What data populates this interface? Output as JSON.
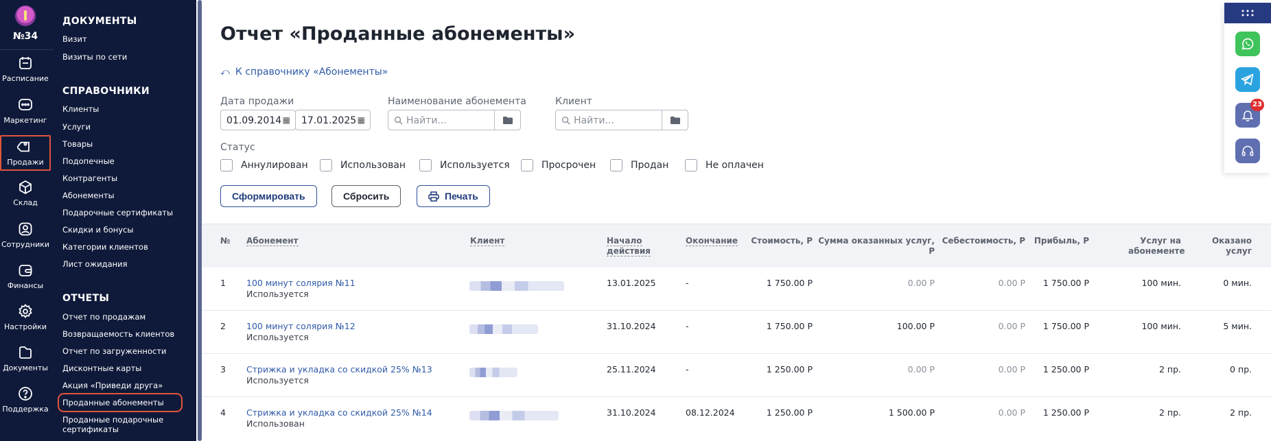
{
  "rail": {
    "branch": "№34",
    "items": [
      {
        "label": "Расписание",
        "icon": "calendar-icon"
      },
      {
        "label": "Маркетинг",
        "icon": "chat-icon"
      },
      {
        "label": "Продажи",
        "icon": "tag-icon"
      },
      {
        "label": "Склад",
        "icon": "box-icon"
      },
      {
        "label": "Сотрудники",
        "icon": "user-icon"
      },
      {
        "label": "Финансы",
        "icon": "wallet-icon"
      },
      {
        "label": "Настройки",
        "icon": "gear-icon"
      },
      {
        "label": "Документы",
        "icon": "folder-icon"
      },
      {
        "label": "Поддержка",
        "icon": "help-icon"
      }
    ],
    "active_index": 2
  },
  "submenu": {
    "documents": {
      "title": "ДОКУМЕНТЫ",
      "items": [
        "Визит",
        "Визиты по сети"
      ]
    },
    "references": {
      "title": "СПРАВОЧНИКИ",
      "items": [
        "Клиенты",
        "Услуги",
        "Товары",
        "Подопечные",
        "Контрагенты",
        "Абонементы",
        "Подарочные сертификаты",
        "Скидки и бонусы",
        "Категории клиентов",
        "Лист ожидания"
      ]
    },
    "reports": {
      "title": "ОТЧЕТЫ",
      "items": [
        "Отчет по продажам",
        "Возвращаемость клиентов",
        "Отчет по загруженности",
        "Дисконтные карты",
        "Акция «Приведи друга»",
        "Проданные абонементы",
        "Проданные подарочные",
        "сертификаты"
      ]
    },
    "active_report": "Проданные абонементы"
  },
  "page": {
    "title": "Отчет «Проданные абонементы»",
    "back_link": "К справочнику «Абонементы»"
  },
  "filters": {
    "sale_date": {
      "label": "Дата продажи",
      "from": "01.09.2014",
      "to": "17.01.2025"
    },
    "subscription_name": {
      "label": "Наименование абонемента",
      "placeholder": "Найти..."
    },
    "client": {
      "label": "Клиент",
      "placeholder": "Найти..."
    },
    "status": {
      "label": "Статус",
      "options": [
        {
          "label": "Аннулирован",
          "checked": false
        },
        {
          "label": "Использован",
          "checked": false
        },
        {
          "label": "Используется",
          "checked": false
        },
        {
          "label": "Просрочен",
          "checked": false
        },
        {
          "label": "Продан",
          "checked": false
        },
        {
          "label": "Не оплачен",
          "checked": false
        }
      ]
    }
  },
  "actions": {
    "generate": "Сформировать",
    "reset": "Сбросить",
    "print": "Печать"
  },
  "table": {
    "headers": {
      "num": "№",
      "subscription": "Абонемент",
      "client": "Клиент",
      "start": "Начало действия",
      "end": "Окончание",
      "cost": "Стоимость, Р",
      "services_sum": "Сумма оказанных услуг, Р",
      "prime_cost": "Себестоимость, Р",
      "profit": "Прибыль, Р",
      "services_total": "Услуг на абонементе",
      "services_done": "Оказано услуг"
    },
    "rows": [
      {
        "num": "1",
        "name": "100 минут солярия №11",
        "status": "Используется",
        "start": "13.01.2025",
        "end": "-",
        "cost": "1 750.00 Р",
        "services_sum": "0.00 Р",
        "prime_cost": "0.00 Р",
        "profit": "1 750.00 Р",
        "services_total": "100 мин.",
        "services_done": "0 мин."
      },
      {
        "num": "2",
        "name": "100 минут солярия №12",
        "status": "Используется",
        "start": "31.10.2024",
        "end": "-",
        "cost": "1 750.00 Р",
        "services_sum": "100.00 Р",
        "prime_cost": "0.00 Р",
        "profit": "1 750.00 Р",
        "services_total": "100 мин.",
        "services_done": "5 мин."
      },
      {
        "num": "3",
        "name": "Стрижка и укладка со скидкой 25% №13",
        "status": "Используется",
        "start": "25.11.2024",
        "end": "-",
        "cost": "1 250.00 Р",
        "services_sum": "0.00 Р",
        "prime_cost": "0.00 Р",
        "profit": "1 250.00 Р",
        "services_total": "2 пр.",
        "services_done": "0 пр."
      },
      {
        "num": "4",
        "name": "Стрижка и укладка со скидкой 25% №14",
        "status": "Использован",
        "start": "31.10.2024",
        "end": "08.12.2024",
        "cost": "1 250.00 Р",
        "services_sum": "1 500.00 Р",
        "prime_cost": "0.00 Р",
        "profit": "1 250.00 Р",
        "services_total": "2 пр.",
        "services_done": "2 пр."
      }
    ]
  },
  "widgets": {
    "notifications_count": "23"
  },
  "colors": {
    "sidebar": "#0f1a3a",
    "accent": "#2f5aa8",
    "highlight": "#e0553a",
    "whatsapp": "#3fc35b",
    "telegram": "#2aa3e0",
    "widget": "#5f6fb0"
  }
}
